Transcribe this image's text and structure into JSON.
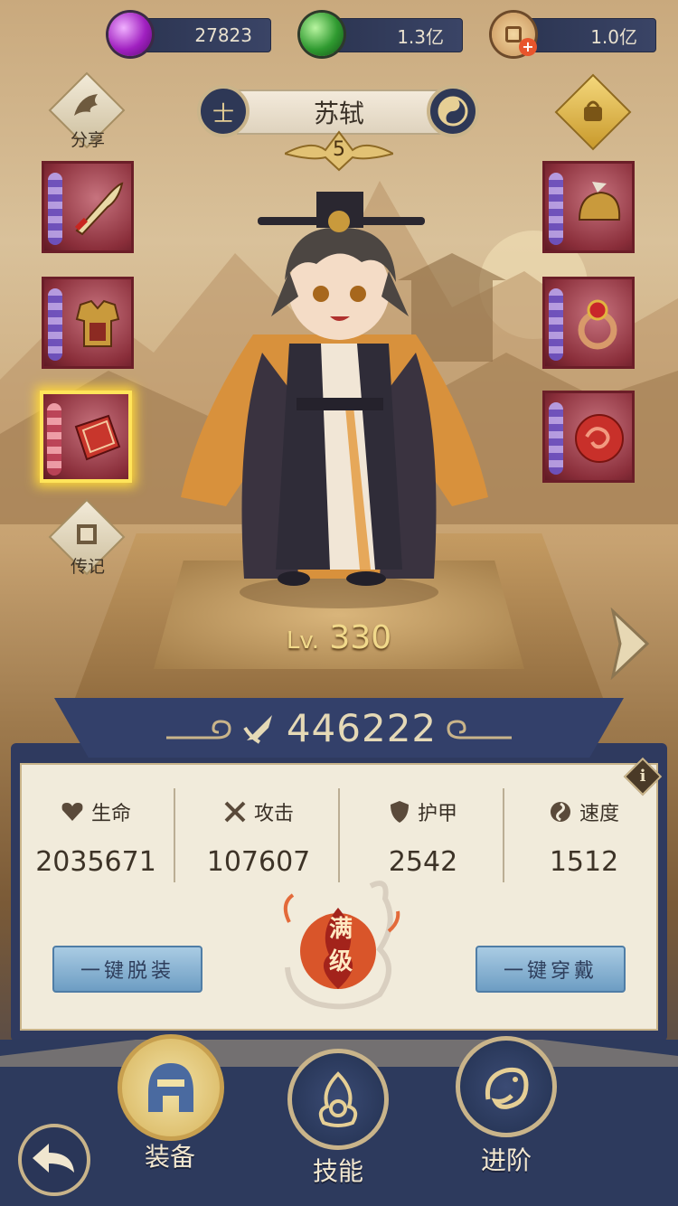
{
  "currency": [
    {
      "icon": "purple-gem-icon",
      "value": "27823"
    },
    {
      "icon": "green-jade-icon",
      "value": "1.3亿"
    },
    {
      "icon": "copper-coin-icon",
      "value": "1.0亿"
    }
  ],
  "hero": {
    "name": "苏轼",
    "stars": "5",
    "level_prefix": "Lv.",
    "level": "330",
    "power": "446222"
  },
  "side_buttons": {
    "share_label": "分享",
    "biography_label": "传记"
  },
  "stats": [
    {
      "icon": "heart-icon",
      "name": "生命",
      "value": "2035671"
    },
    {
      "icon": "crossed-swords-icon",
      "name": "攻击",
      "value": "107607"
    },
    {
      "icon": "shield-icon",
      "name": "护甲",
      "value": "2542"
    },
    {
      "icon": "swirl-icon",
      "name": "速度",
      "value": "1512"
    }
  ],
  "actions": {
    "unequip_all": "一键脱装",
    "equip_all": "一键穿戴",
    "maxed_line1": "满",
    "maxed_line2": "级"
  },
  "nav": {
    "equipment": "装备",
    "skills": "技能",
    "advance": "进阶"
  },
  "info_glyph": "i",
  "title_left_glyph": "士",
  "colors": {
    "panel_navy": "#2f3a5f",
    "panel_parchment": "#f1ebdb",
    "accent_gold": "#d7b45b",
    "slot_red": "#8a2e3a",
    "selected_highlight": "#ffe45a"
  }
}
